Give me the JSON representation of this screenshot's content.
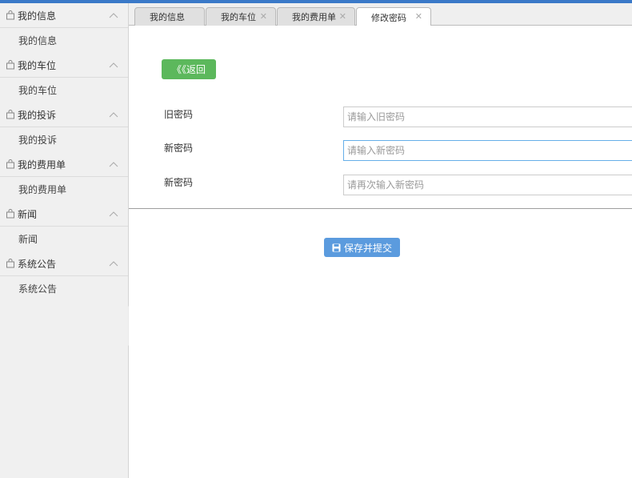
{
  "sidebar": {
    "groups": [
      {
        "title": "我的信息",
        "items": [
          "我的信息"
        ]
      },
      {
        "title": "我的车位",
        "items": [
          "我的车位"
        ]
      },
      {
        "title": "我的投诉",
        "items": [
          "我的投诉"
        ]
      },
      {
        "title": "我的费用单",
        "items": [
          "我的费用单"
        ]
      },
      {
        "title": "新闻",
        "items": [
          "新闻"
        ]
      },
      {
        "title": "系统公告",
        "items": [
          "系统公告"
        ]
      }
    ]
  },
  "tabs": [
    {
      "label": "我的信息",
      "closable": false
    },
    {
      "label": "我的车位",
      "closable": true
    },
    {
      "label": "我的费用单",
      "closable": true
    },
    {
      "label": "修改密码",
      "closable": true,
      "active": true
    }
  ],
  "form": {
    "back_label": "《《返回",
    "fields": [
      {
        "label": "旧密码",
        "placeholder": "请输入旧密码",
        "value": ""
      },
      {
        "label": "新密码",
        "placeholder": "请输入新密码",
        "value": ""
      },
      {
        "label": "新密码",
        "placeholder": "请再次输入新密码",
        "value": ""
      }
    ],
    "save_label": "保存并提交"
  },
  "icons": {
    "group": "shopping-bag-icon",
    "expand": "chevron-up-icon",
    "close": "close-icon",
    "collapse": "chevron-left-icon",
    "save": "floppy-disk-icon"
  },
  "colors": {
    "topbar": "#3a79c8",
    "back_button": "#5cb85c",
    "save_button": "#5b9bde",
    "focus_border": "#66afe9"
  }
}
